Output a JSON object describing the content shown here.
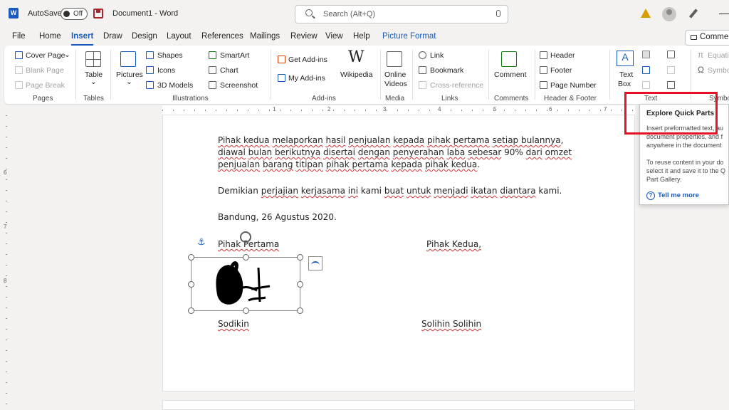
{
  "titlebar": {
    "app_logo": "W",
    "autosave_label": "AutoSave",
    "autosave_state": "Off",
    "document_title": "Document1  -  Word",
    "search_placeholder": "Search (Alt+Q)"
  },
  "tabs": [
    "File",
    "Home",
    "Insert",
    "Draw",
    "Design",
    "Layout",
    "References",
    "Mailings",
    "Review",
    "View",
    "Help",
    "Picture Format"
  ],
  "active_tab": "Insert",
  "comments_button": "Comments",
  "ribbon": {
    "pages": {
      "label": "Pages",
      "cover_page": "Cover Page",
      "blank_page": "Blank Page",
      "page_break": "Page Break"
    },
    "tables": {
      "label": "Tables",
      "table": "Table"
    },
    "illustrations": {
      "label": "Illustrations",
      "pictures": "Pictures",
      "shapes": "Shapes",
      "icons": "Icons",
      "models": "3D Models",
      "smartart": "SmartArt",
      "chart": "Chart",
      "screenshot": "Screenshot"
    },
    "addins": {
      "label": "Add-ins",
      "get": "Get Add-ins",
      "my": "My Add-ins",
      "wikipedia": "Wikipedia",
      "wiki_logo": "W"
    },
    "media": {
      "label": "Media",
      "online_videos_1": "Online",
      "online_videos_2": "Videos"
    },
    "links": {
      "label": "Links",
      "link": "Link",
      "bookmark": "Bookmark",
      "cross_reference": "Cross-reference"
    },
    "comments": {
      "label": "Comments",
      "comment": "Comment"
    },
    "header_footer": {
      "label": "Header & Footer",
      "header": "Header",
      "footer": "Footer",
      "page_number": "Page Number"
    },
    "text": {
      "label": "Text",
      "text_box_1": "Text",
      "text_box_2": "Box",
      "text_box_glyph": "A"
    },
    "symbols": {
      "label": "Symbo",
      "equation": "Equatio",
      "symbol": "Symbo",
      "pi": "π",
      "omega": "Ω"
    }
  },
  "ruler": {
    "numbers": [
      "1",
      "2",
      "3",
      "4",
      "5",
      "6",
      "7"
    ],
    "vnumbers": [
      "6",
      "7",
      "8"
    ]
  },
  "document": {
    "para1_line1": [
      {
        "t": "Pihak kedua",
        "sq": true
      },
      {
        "t": " "
      },
      {
        "t": "melaporkan",
        "sq": true
      },
      {
        "t": " "
      },
      {
        "t": "hasil",
        "sq": true
      },
      {
        "t": " "
      },
      {
        "t": "penjualan",
        "sq": true
      },
      {
        "t": " "
      },
      {
        "t": "kepada",
        "sq": true
      },
      {
        "t": " "
      },
      {
        "t": "pihak pertama",
        "sq": true
      },
      {
        "t": " "
      },
      {
        "t": "setiap bulannya",
        "sq": true
      },
      {
        "t": ","
      }
    ],
    "para1_line2": [
      {
        "t": "diawal",
        "sq": true
      },
      {
        "t": " "
      },
      {
        "t": "bulan",
        "sq": true
      },
      {
        "t": " "
      },
      {
        "t": "berikutnya",
        "sq": true
      },
      {
        "t": " "
      },
      {
        "t": "disertai",
        "sq": true
      },
      {
        "t": " "
      },
      {
        "t": "dengan",
        "sq": true
      },
      {
        "t": " "
      },
      {
        "t": "penyerahan",
        "sq": true
      },
      {
        "t": " "
      },
      {
        "t": "laba",
        "sq": true
      },
      {
        "t": " "
      },
      {
        "t": "sebesar",
        "sq": true
      },
      {
        "t": " 90% "
      },
      {
        "t": "dari",
        "sq": true
      },
      {
        "t": " "
      },
      {
        "t": "omzet",
        "sq": true
      }
    ],
    "para1_line3": [
      {
        "t": "penjualan",
        "sq": true
      },
      {
        "t": " "
      },
      {
        "t": "barang",
        "sq": true
      },
      {
        "t": " "
      },
      {
        "t": "titipan",
        "sq": true
      },
      {
        "t": " "
      },
      {
        "t": "pihak pertama",
        "sq": true
      },
      {
        "t": " "
      },
      {
        "t": "kepada",
        "sq": true
      },
      {
        "t": " "
      },
      {
        "t": "pihak kedua",
        "sq": true
      },
      {
        "t": "."
      }
    ],
    "para2": [
      {
        "t": "Demikian "
      },
      {
        "t": "perjajian",
        "sq": true
      },
      {
        "t": " "
      },
      {
        "t": "kerjasama",
        "sq": true
      },
      {
        "t": " "
      },
      {
        "t": "ini",
        "sq": true
      },
      {
        "t": " kami "
      },
      {
        "t": "buat",
        "sq": true
      },
      {
        "t": " "
      },
      {
        "t": "untuk",
        "sq": true
      },
      {
        "t": " "
      },
      {
        "t": "menjadi",
        "sq": true
      },
      {
        "t": " "
      },
      {
        "t": "ikatan",
        "sq": true
      },
      {
        "t": " "
      },
      {
        "t": "diantara",
        "sq": true
      },
      {
        "t": " kami."
      }
    ],
    "place_date": "Bandung, 26 Agustus 2020.",
    "party1": "Pihak Pertama",
    "party2": "Pihak Kedua,",
    "signer1": "Sodikin",
    "signer2": "Solihin Solihin"
  },
  "tooltip": {
    "title": "Explore Quick Parts",
    "body1": "Insert preformatted text, au\ndocument properties, and f\nanywhere in the document",
    "body2": "To reuse content in your do\nselect it and save it to the Q\nPart Gallery.",
    "link": "Tell me more",
    "help_glyph": "?"
  },
  "colors": {
    "accent": "#185abd",
    "highlight": "#e81123",
    "spellcheck": "#d13438"
  }
}
